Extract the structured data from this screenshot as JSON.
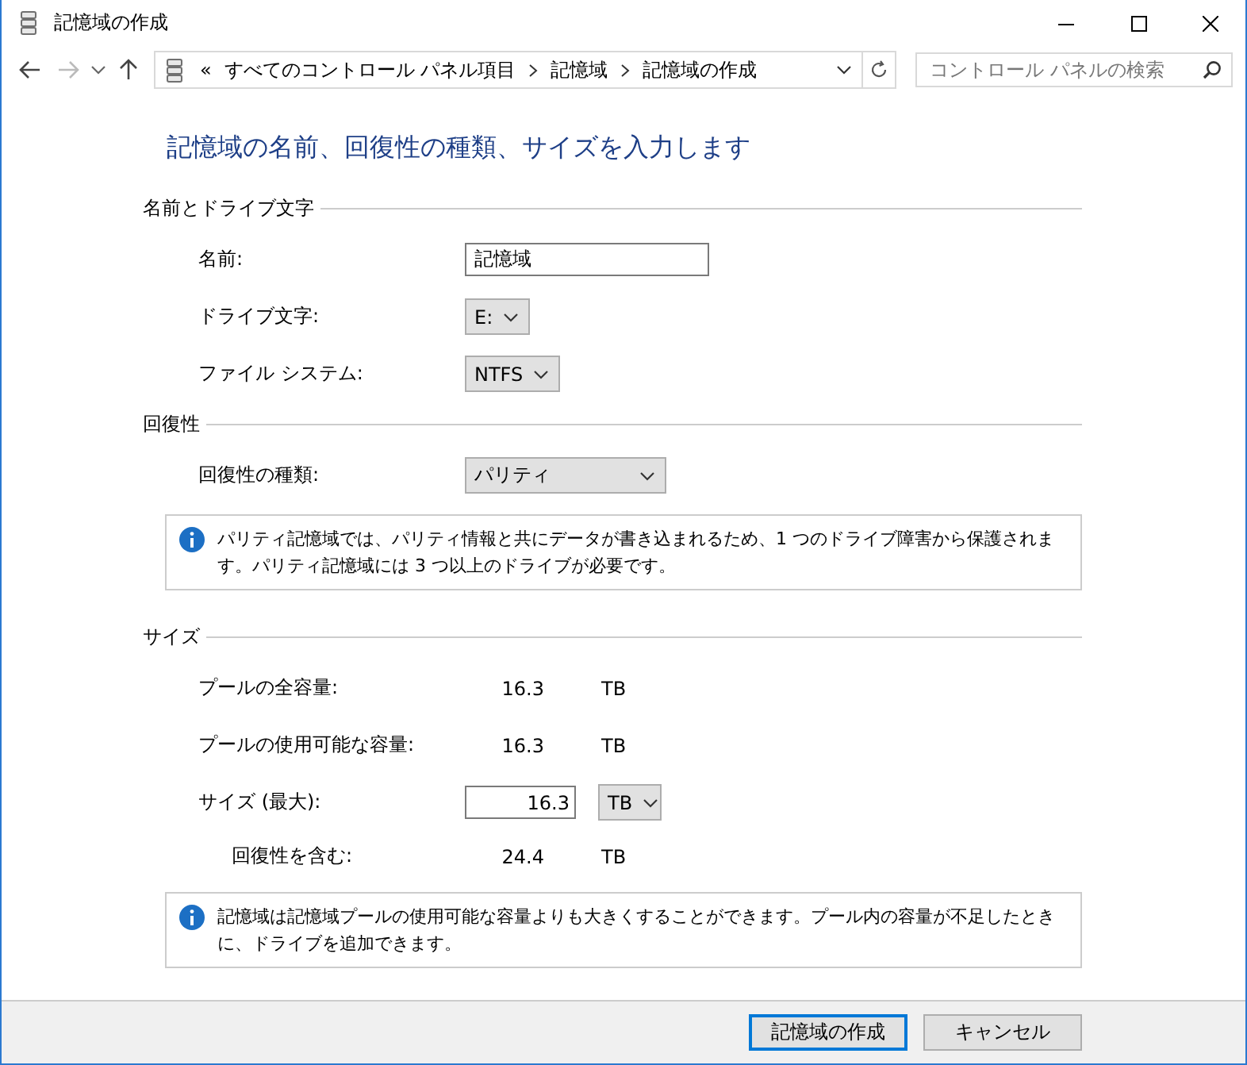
{
  "window": {
    "title": "記憶域の作成"
  },
  "address": {
    "prefix": "«",
    "crumbs": [
      "すべてのコントロール パネル項目",
      "記憶域",
      "記憶域の作成"
    ]
  },
  "search": {
    "placeholder": "コントロール パネルの検索"
  },
  "heading": "記憶域の名前、回復性の種類、サイズを入力します",
  "sections": [
    {
      "title": "名前とドライブ文字",
      "rows": [
        {
          "kind": "text-field",
          "label": "名前:",
          "value": "記憶域"
        },
        {
          "kind": "dropdown",
          "label": "ドライブ文字:",
          "value": "E:"
        },
        {
          "kind": "dropdown",
          "label": "ファイル システム:",
          "value": "NTFS"
        }
      ]
    },
    {
      "title": "回復性",
      "rows": [
        {
          "kind": "dropdown-wide",
          "label": "回復性の種類:",
          "value": "パリティ"
        }
      ],
      "info": "パリティ記憶域では、パリティ情報と共にデータが書き込まれるため、1 つのドライブ障害から保護されます。パリティ記憶域には 3 つ以上のドライブが必要です。"
    },
    {
      "title": "サイズ",
      "rows": [
        {
          "kind": "readout",
          "label": "プールの全容量:",
          "value": "16.3",
          "unit": "TB"
        },
        {
          "kind": "readout",
          "label": "プールの使用可能な容量:",
          "value": "16.3",
          "unit": "TB"
        },
        {
          "kind": "number-field",
          "label": "サイズ (最大):",
          "value": "16.3",
          "unit": "TB",
          "children": [
            {
              "kind": "readout",
              "label": "回復性を含む:",
              "value": "24.4",
              "unit": "TB"
            }
          ]
        }
      ],
      "info": "記憶域は記憶域プールの使用可能な容量よりも大きくすることができます。プール内の容量が不足したときに、ドライブを追加できます。"
    }
  ],
  "buttons": [
    {
      "label": "記憶域の作成",
      "default": true
    },
    {
      "label": "キャンセル",
      "default": false
    }
  ]
}
